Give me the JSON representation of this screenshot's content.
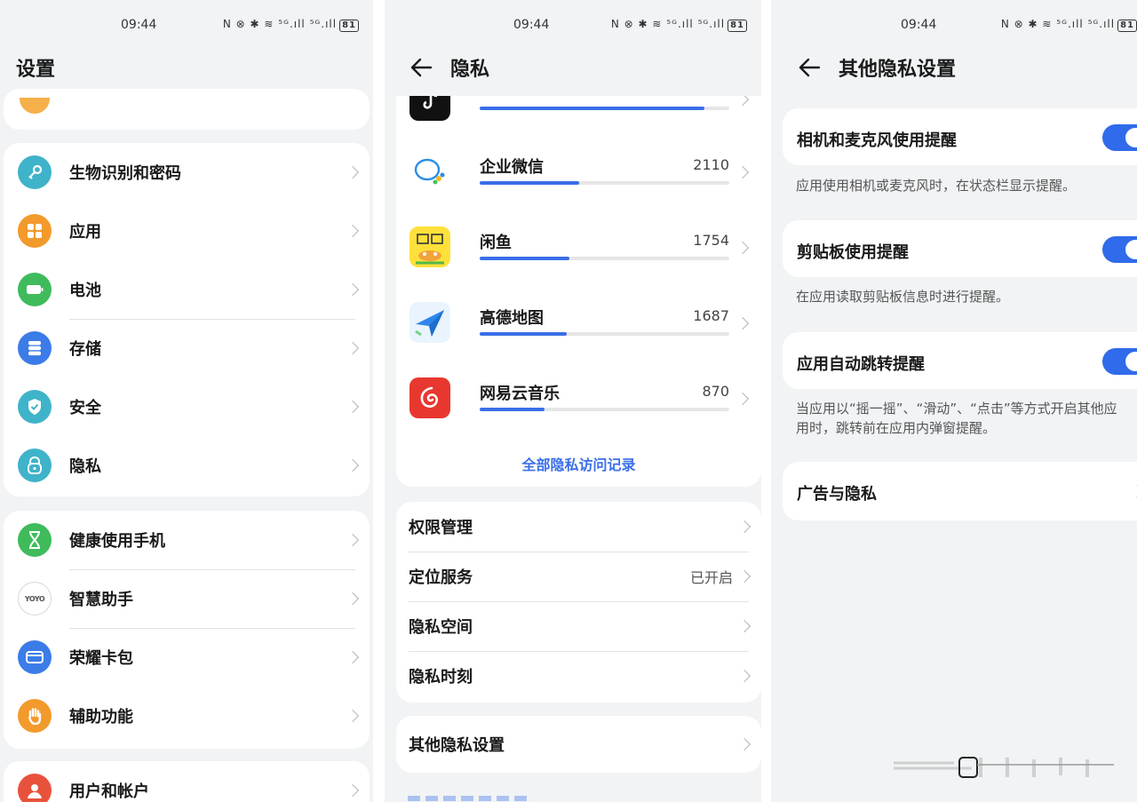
{
  "status": {
    "time": "09:44",
    "icons": "N ⊗ ✱ ≋ ⁵ᴳ.ıll ⁵ᴳ.ıll",
    "battery": "81"
  },
  "settings": {
    "title": "设置",
    "group1": [
      {
        "label": "生物识别和密码",
        "icon": "key-icon",
        "color": "#3fb3c9"
      },
      {
        "label": "应用",
        "icon": "apps-grid-icon",
        "color": "#f39a2c"
      },
      {
        "label": "电池",
        "icon": "battery-icon",
        "color": "#3fbb5c"
      },
      {
        "label": "存储",
        "icon": "storage-icon",
        "color": "#3c7ce8"
      },
      {
        "label": "安全",
        "icon": "shield-check-icon",
        "color": "#3fb3c9"
      },
      {
        "label": "隐私",
        "icon": "privacy-lock-icon",
        "color": "#3fb3c9"
      }
    ],
    "group2": [
      {
        "label": "健康使用手机",
        "icon": "hourglass-icon",
        "color": "#3fbb5c"
      },
      {
        "label": "智慧助手",
        "icon": "yoyo-icon",
        "color": "#ffffff"
      },
      {
        "label": "荣耀卡包",
        "icon": "wallet-icon",
        "color": "#3c7ce8"
      },
      {
        "label": "辅助功能",
        "icon": "hand-icon",
        "color": "#f39a2c"
      }
    ],
    "group3": [
      {
        "label": "用户和帐户",
        "icon": "user-icon",
        "color": "#e8523c"
      }
    ]
  },
  "privacy": {
    "title": "隐私",
    "apps": [
      {
        "name": "企业微信",
        "count": "2110",
        "fraction": 0.4,
        "icon": "wecom-icon"
      },
      {
        "name": "闲鱼",
        "count": "1754",
        "fraction": 0.36,
        "icon": "xianyu-icon"
      },
      {
        "name": "高德地图",
        "count": "1687",
        "fraction": 0.35,
        "icon": "amap-icon"
      },
      {
        "name": "网易云音乐",
        "count": "870",
        "fraction": 0.26,
        "icon": "netease-music-icon"
      }
    ],
    "top_partial_fraction": 0.9,
    "all_records_link": "全部隐私访问记录",
    "menu": [
      {
        "label": "权限管理",
        "value": ""
      },
      {
        "label": "定位服务",
        "value": "已开启"
      },
      {
        "label": "隐私空间",
        "value": ""
      },
      {
        "label": "隐私时刻",
        "value": ""
      }
    ],
    "other_settings": "其他隐私设置",
    "accent": "#3a6ee8"
  },
  "other": {
    "title": "其他隐私设置",
    "toggles": [
      {
        "label": "相机和麦克风使用提醒",
        "desc": "应用使用相机或麦克风时，在状态栏显示提醒。",
        "on": true
      },
      {
        "label": "剪贴板使用提醒",
        "desc": "在应用读取剪贴板信息时进行提醒。",
        "on": true
      },
      {
        "label": "应用自动跳转提醒",
        "desc": "当应用以“摇一摇”、“滑动”、“点击”等方式开启其他应用时，跳转前在应用内弹窗提醒。",
        "on": true
      }
    ],
    "ads": "广告与隐私",
    "toggle_color": "#2f6bea"
  }
}
